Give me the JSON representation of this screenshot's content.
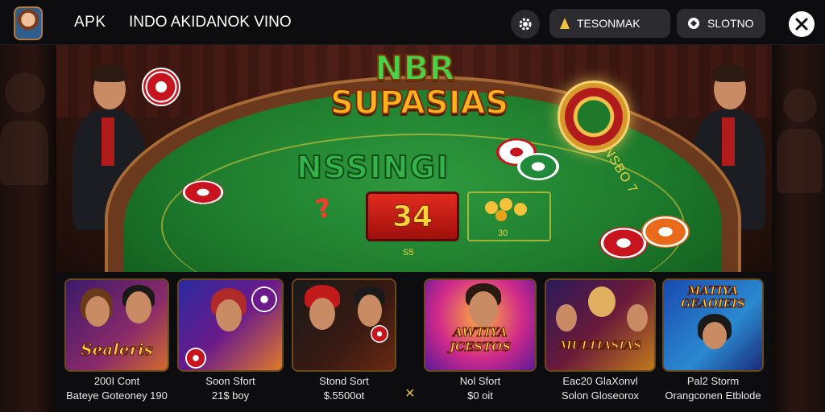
{
  "header": {
    "apk_label": "APK",
    "brand_title": "INDO AKIDANOK VINO",
    "wallet_label": "TESONMAK",
    "slot_label": "SLOTNO"
  },
  "hero": {
    "logo_line1": "NBR",
    "logo_line2": "SUPASIAS",
    "felt_title": "NSSINGI",
    "score_value": "34",
    "qmark": "?",
    "box_label": "30",
    "small_label": "S5",
    "side_text": "NSBO 7"
  },
  "games": [
    {
      "title": "Sealeris",
      "caption1": "200I Cont",
      "caption2": "Bateye Goteoney 190",
      "theme": "#7a2a8a"
    },
    {
      "title": "",
      "caption1": "Soon Sfort",
      "caption2": "21$ boy",
      "theme": "#2a2a9a"
    },
    {
      "title": "",
      "caption1": "Stond Sort",
      "caption2": "$.5500ot",
      "theme": "#3a1a12"
    },
    {
      "title": "AWTIYA JCESTOS",
      "caption1": "Nol Sfort",
      "caption2": "$0 oit",
      "theme": "#8a3ac0"
    },
    {
      "title": "MULTIASIAS",
      "caption1": "Eac20 GlaXonvl",
      "caption2": "Solon Gloseorox",
      "theme": "#3a2a6a"
    },
    {
      "title": "MATIYA GEAOIEIS",
      "caption1": "Pal2 Storm",
      "caption2": "Orangconen Etblode",
      "theme": "#2a4aa0"
    }
  ],
  "divider_mark": "×",
  "colors": {
    "felt": "#1d7a2c",
    "gold": "#ffcf3a",
    "chip_red": "#c8141e"
  },
  "icons": [
    "gear-icon",
    "warning-icon",
    "refresh-icon",
    "close-icon"
  ]
}
